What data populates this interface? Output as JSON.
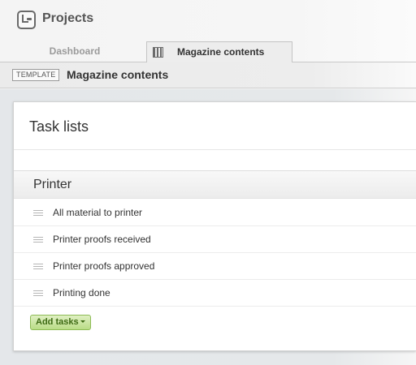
{
  "app": {
    "title": "Projects",
    "icon": "projects-icon"
  },
  "tabs": [
    {
      "label": "Dashboard",
      "active": false
    },
    {
      "label": "Magazine contents",
      "active": true,
      "icon": "template-grid-icon"
    }
  ],
  "subheader": {
    "badge": "TEMPLATE",
    "title": "Magazine contents"
  },
  "panel": {
    "title": "Task lists",
    "list": {
      "name": "Printer",
      "tasks": [
        "All material to printer",
        "Printer proofs received",
        "Printer proofs approved",
        "Printing done"
      ],
      "add_button": "Add tasks"
    }
  },
  "colors": {
    "add_button_bg": "#c8e4a0",
    "add_button_text": "#3d6a13"
  }
}
